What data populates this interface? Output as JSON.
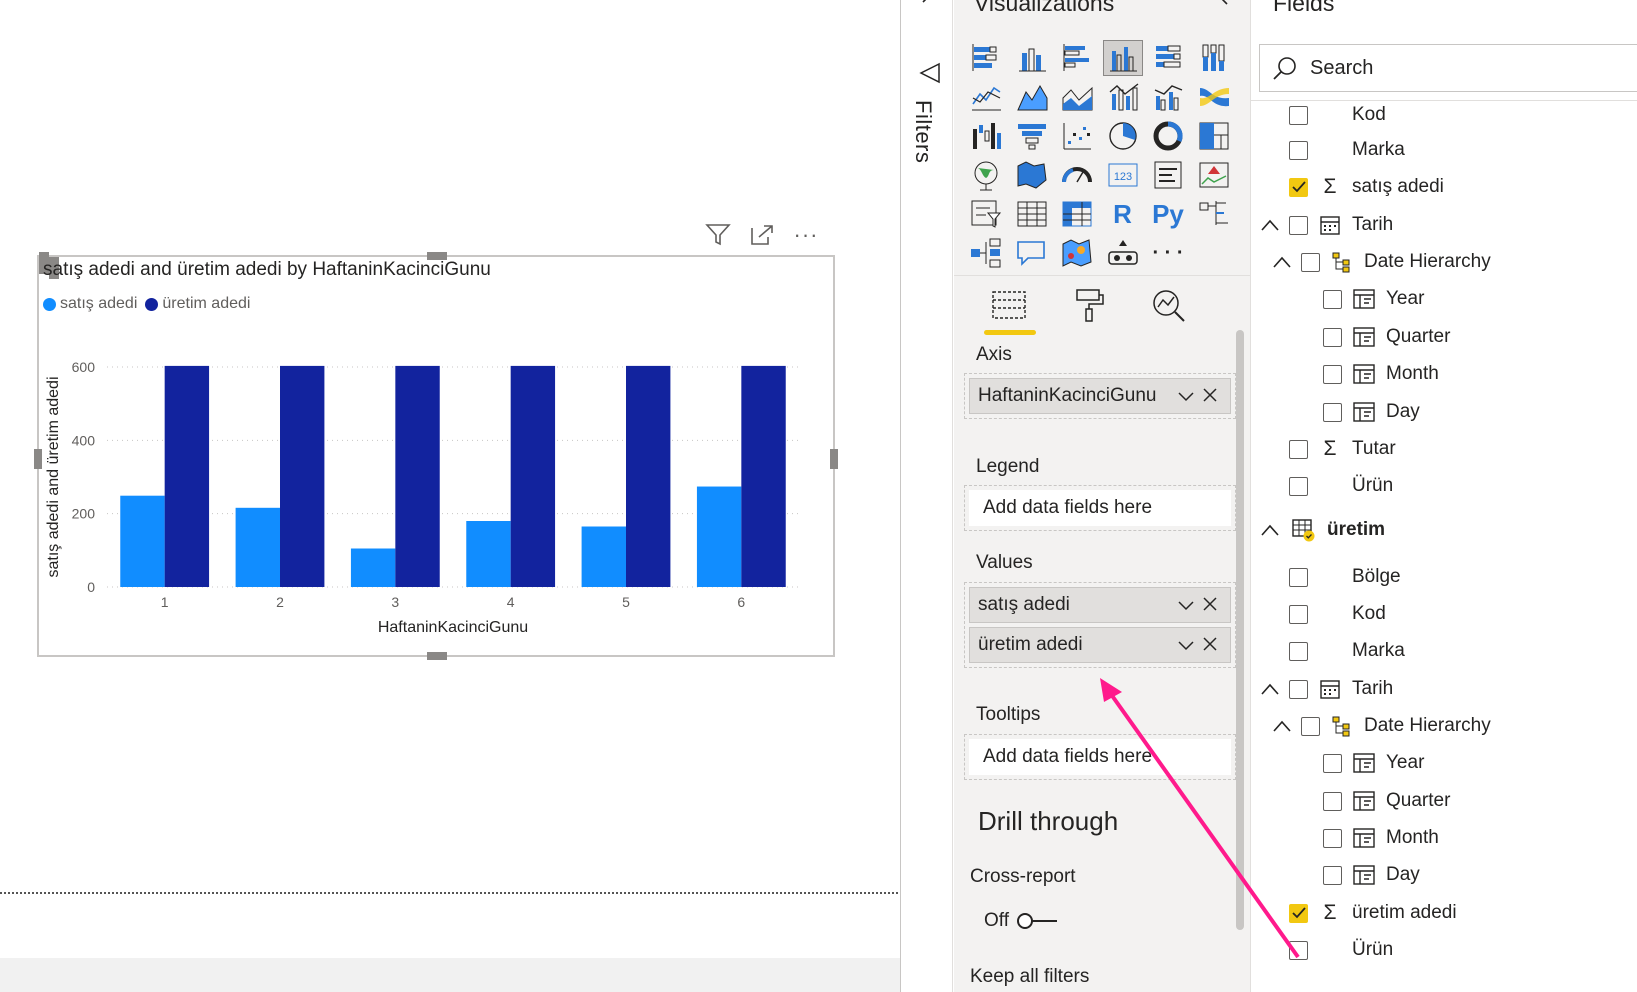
{
  "visual": {
    "header_icons": [
      "filter-icon",
      "focus-mode-icon",
      "more-options-icon"
    ],
    "more_glyph": "···"
  },
  "chart_data": {
    "type": "bar",
    "title": "satış adedi and üretim adedi by HaftaninKacinciGunu",
    "xlabel": "HaftaninKacinciGunu",
    "ylabel": "satış adedi and üretim adedi",
    "categories": [
      "1",
      "2",
      "3",
      "4",
      "5",
      "6"
    ],
    "yticks": [
      "0",
      "200",
      "400",
      "600"
    ],
    "ylim": [
      0,
      600
    ],
    "grid": true,
    "legend_position": "top-left",
    "series": [
      {
        "name": "satış adedi",
        "color": "#118dff",
        "values": [
          249,
          216,
          105,
          180,
          165,
          274
        ]
      },
      {
        "name": "üretim adedi",
        "color": "#12239e",
        "values": [
          603,
          603,
          603,
          603,
          603,
          603
        ]
      }
    ]
  },
  "filters": {
    "label": "Filters"
  },
  "viz_pane": {
    "title": "Visualizations",
    "icons": [
      "stacked-bar-chart-icon",
      "stacked-column-chart-icon",
      "clustered-bar-chart-icon",
      "clustered-column-chart-icon",
      "100-stacked-bar-chart-icon",
      "100-stacked-column-chart-icon",
      "line-chart-icon",
      "area-chart-icon",
      "stacked-area-chart-icon",
      "line-and-stacked-column-icon",
      "line-and-clustered-column-icon",
      "ribbon-chart-icon",
      "waterfall-chart-icon",
      "funnel-icon",
      "scatter-chart-icon",
      "pie-chart-icon",
      "donut-chart-icon",
      "treemap-icon",
      "map-icon",
      "filled-map-icon",
      "gauge-icon",
      "card-icon",
      "multi-row-card-icon",
      "kpi-icon",
      "slicer-icon",
      "table-icon",
      "matrix-icon",
      "r-visual-icon",
      "python-visual-icon",
      "key-influencers-icon",
      "decomposition-tree-icon",
      "qa-icon",
      "azure-map-icon",
      "paginated-report-icon",
      "more-visuals-icon"
    ],
    "r_text": "R",
    "py_text": "Py",
    "more_text": "· · ·",
    "tabs": [
      "fields-tab-icon",
      "format-tab-icon",
      "analytics-tab-icon"
    ],
    "wells": {
      "axis_label": "Axis",
      "axis_field": "HaftaninKacinciGunu",
      "legend_label": "Legend",
      "legend_placeholder": "Add data fields here",
      "values_label": "Values",
      "values_fields": [
        "satış adedi",
        "üretim adedi"
      ],
      "tooltips_label": "Tooltips",
      "tooltips_placeholder": "Add data fields here"
    },
    "drill_title": "Drill through",
    "cross_report": "Cross-report",
    "toggle_state": "Off",
    "keep_filters": "Keep all filters"
  },
  "fields_pane": {
    "title": "Fields",
    "search_placeholder": "Search",
    "rows": [
      {
        "label": "Kod",
        "checked": false,
        "icon": "",
        "level": 1
      },
      {
        "label": "Marka",
        "checked": false,
        "icon": "",
        "level": 1
      },
      {
        "label": "satış adedi",
        "checked": true,
        "icon": "sigma",
        "level": 1
      },
      {
        "label": "Tarih",
        "checked": false,
        "icon": "calendar",
        "level": 1,
        "expander": true
      },
      {
        "label": "Date Hierarchy",
        "checked": false,
        "icon": "hierarchy",
        "level": 2,
        "expander": true
      },
      {
        "label": "Year",
        "checked": false,
        "icon": "date-part",
        "level": 3
      },
      {
        "label": "Quarter",
        "checked": false,
        "icon": "date-part",
        "level": 3
      },
      {
        "label": "Month",
        "checked": false,
        "icon": "date-part",
        "level": 3
      },
      {
        "label": "Day",
        "checked": false,
        "icon": "date-part",
        "level": 3
      },
      {
        "label": "Tutar",
        "checked": false,
        "icon": "sigma",
        "level": 1
      },
      {
        "label": "Ürün",
        "checked": false,
        "icon": "",
        "level": 1
      },
      {
        "label": "üretim",
        "checked": true,
        "icon": "table",
        "level": 0,
        "expander": true
      },
      {
        "label": "Bölge",
        "checked": false,
        "icon": "",
        "level": 1
      },
      {
        "label": "Kod",
        "checked": false,
        "icon": "",
        "level": 1
      },
      {
        "label": "Marka",
        "checked": false,
        "icon": "",
        "level": 1
      },
      {
        "label": "Tarih",
        "checked": false,
        "icon": "calendar",
        "level": 1,
        "expander": true
      },
      {
        "label": "Date Hierarchy",
        "checked": false,
        "icon": "hierarchy",
        "level": 2,
        "expander": true
      },
      {
        "label": "Year",
        "checked": false,
        "icon": "date-part",
        "level": 3
      },
      {
        "label": "Quarter",
        "checked": false,
        "icon": "date-part",
        "level": 3
      },
      {
        "label": "Month",
        "checked": false,
        "icon": "date-part",
        "level": 3
      },
      {
        "label": "Day",
        "checked": false,
        "icon": "date-part",
        "level": 3
      },
      {
        "label": "üretim adedi",
        "checked": true,
        "icon": "sigma",
        "level": 1
      },
      {
        "label": "Ürün",
        "checked": false,
        "icon": "",
        "level": 1
      }
    ]
  },
  "colors": {
    "accent": "#f2c811",
    "annotation_arrow": "#ff1a8c",
    "series1": "#118dff",
    "series2": "#12239e"
  }
}
